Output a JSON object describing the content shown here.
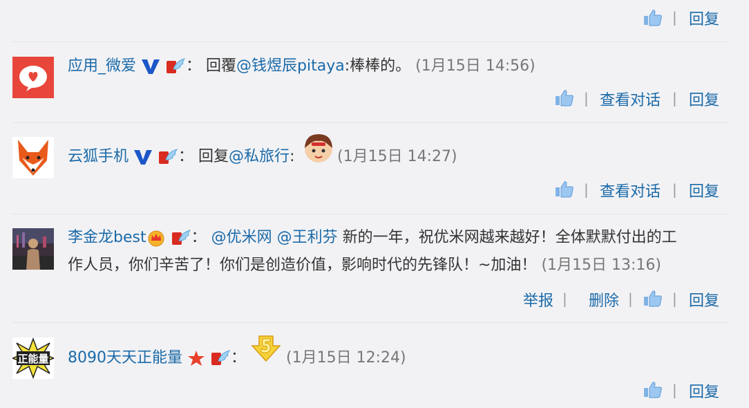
{
  "labels": {
    "reply": "回复",
    "view_conversation": "查看对话",
    "report": "举报",
    "delete": "删除",
    "sep": "|"
  },
  "comments": [
    {
      "user": "应用_微爱",
      "colon": "：",
      "prefix": "回覆",
      "mention": "@钱煜辰pitaya",
      "text": ":棒棒的。",
      "time": "(1月15日 14:56)"
    },
    {
      "user": "云狐手机",
      "colon": "：",
      "prefix": "回复",
      "mention": "@私旅行",
      "text": ":",
      "time": "(1月15日 14:27)"
    },
    {
      "user": "李金龙best",
      "colon": "：",
      "mention1": "@优米网",
      "mention2": "@王利芬",
      "text_line1": "新的一年，祝优米网越来越好！全体默默付出的工",
      "text_line2": "作人员，你们辛苦了！你们是创造价值，影响时代的先锋队！~加油！",
      "time": "(1月15日 13:16)"
    },
    {
      "user": "8090天天正能量",
      "colon": "：",
      "time": "(1月15日 12:24)",
      "avatar_text": "正能量"
    }
  ],
  "colors": {
    "link": "#1b6aa8",
    "verified_blue": "#1c57c8",
    "badge_red": "#d92b20",
    "background": "#f2f2f5"
  }
}
